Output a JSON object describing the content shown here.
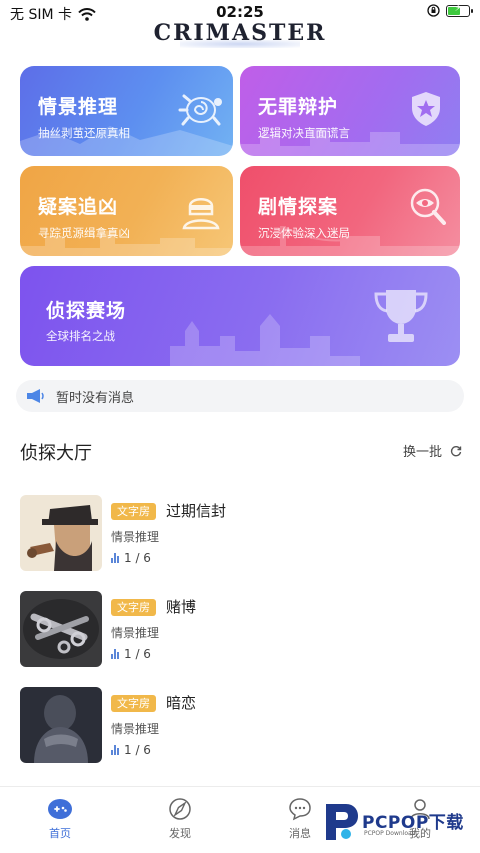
{
  "status_bar": {
    "carrier": "无 SIM 卡",
    "time": "02:25"
  },
  "app": {
    "logo": "CRIMASTER"
  },
  "cards": [
    {
      "title": "情景推理",
      "subtitle": "抽丝剥茧还原真相",
      "icon": "turtle-icon"
    },
    {
      "title": "无罪辩护",
      "subtitle": "逻辑对决直面谎言",
      "icon": "police-badge-icon"
    },
    {
      "title": "疑案追凶",
      "subtitle": "寻踪觅源缉拿真凶",
      "icon": "ninja-icon"
    },
    {
      "title": "剧情探案",
      "subtitle": "沉浸体验深入迷局",
      "icon": "magnifier-eye-icon"
    },
    {
      "title": "侦探赛场",
      "subtitle": "全球排名之战",
      "icon": "trophy-icon"
    }
  ],
  "notice": {
    "text": "暂时没有消息",
    "icon": "megaphone-icon"
  },
  "section": {
    "title": "侦探大厅",
    "refresh_label": "换一批"
  },
  "rooms": [
    {
      "tag": "文字房",
      "title": "过期信封",
      "category": "情景推理",
      "count": "1 / 6"
    },
    {
      "tag": "文字房",
      "title": "赌博",
      "category": "情景推理",
      "count": "1 / 6"
    },
    {
      "tag": "文字房",
      "title": "暗恋",
      "category": "情景推理",
      "count": "1 / 6"
    }
  ],
  "tabs": [
    {
      "label": "首页",
      "icon": "home-icon",
      "active": true
    },
    {
      "label": "发现",
      "icon": "compass-icon",
      "active": false
    },
    {
      "label": "消息",
      "icon": "chat-icon",
      "active": false
    },
    {
      "label": "我的",
      "icon": "user-icon",
      "active": false
    }
  ],
  "watermark": {
    "text": "PCPOP下载",
    "sub": "PCPOP Download"
  },
  "colors": {
    "accent": "#3f6fd8",
    "tag": "#f1b84a"
  }
}
